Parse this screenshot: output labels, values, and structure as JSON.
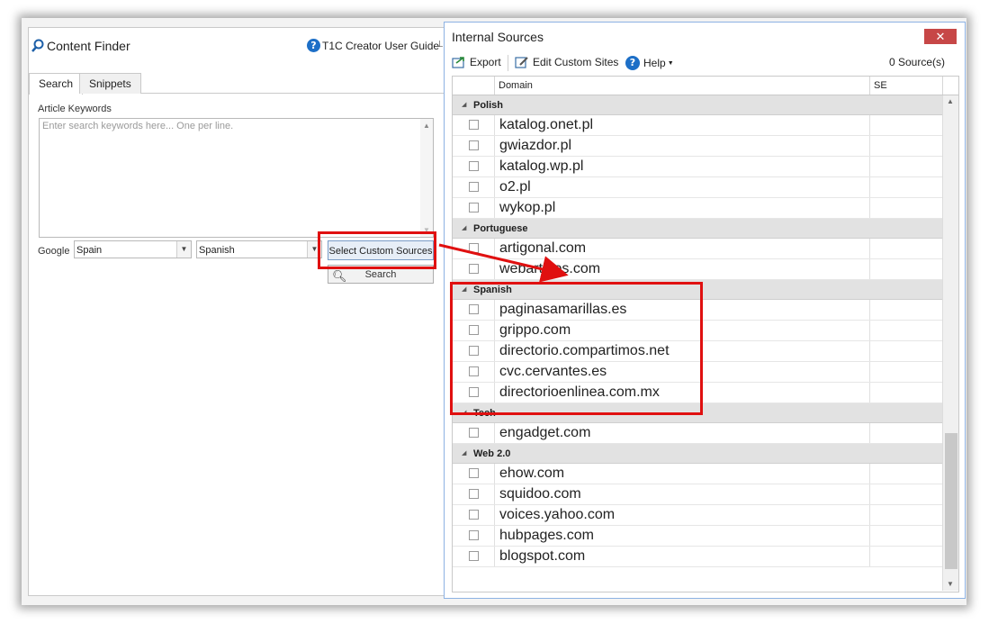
{
  "content_finder": {
    "title": "Content Finder",
    "guide_label": "T1C Creator User Guide",
    "pin_glyph": "⊥",
    "tabs": [
      {
        "label": "Search",
        "active": true
      },
      {
        "label": "Snippets",
        "active": false
      }
    ],
    "keywords_label": "Article Keywords",
    "keywords_placeholder": "Enter search keywords here... One per line.",
    "google_label": "Google",
    "country_value": "Spain",
    "language_value": "Spanish",
    "select_sources_label": "Select Custom Sources",
    "search_label": "Search"
  },
  "internal_sources": {
    "title": "Internal Sources",
    "close_glyph": "✕",
    "toolbar": {
      "export_label": "Export",
      "edit_label": "Edit Custom Sites",
      "help_label": "Help",
      "source_count": "0 Source(s)"
    },
    "columns": {
      "domain": "Domain",
      "se": "SE"
    },
    "groups": [
      {
        "name": "Polish",
        "items": [
          "katalog.onet.pl",
          "gwiazdor.pl",
          "katalog.wp.pl",
          "o2.pl",
          "wykop.pl"
        ]
      },
      {
        "name": "Portuguese",
        "items": [
          "artigonal.com",
          "webartigos.com"
        ]
      },
      {
        "name": "Spanish",
        "items": [
          "paginasamarillas.es",
          "grippo.com",
          "directorio.compartimos.net",
          "cvc.cervantes.es",
          "directorioenlinea.com.mx"
        ]
      },
      {
        "name": "Tech",
        "items": [
          "engadget.com"
        ]
      },
      {
        "name": "Web 2.0",
        "items": [
          "ehow.com",
          "squidoo.com",
          "voices.yahoo.com",
          "hubpages.com",
          "blogspot.com"
        ]
      }
    ]
  },
  "colors": {
    "highlight": "#e01010",
    "accent": "#1d6fc7",
    "close_button": "#c74747"
  }
}
